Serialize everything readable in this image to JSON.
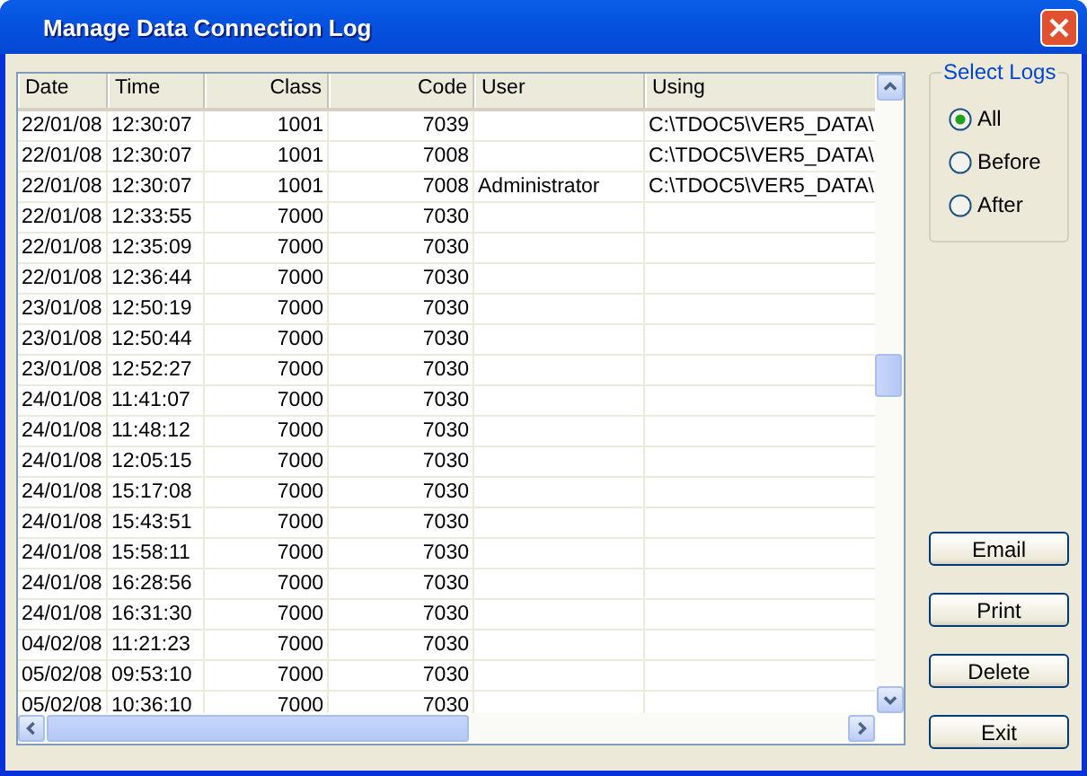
{
  "window": {
    "title": "Manage Data Connection Log"
  },
  "table": {
    "columns": [
      "Date",
      "Time",
      "Class",
      "Code",
      "User",
      "Using"
    ],
    "rows": [
      [
        "22/01/08",
        "12:30:07",
        "1001",
        "7039",
        "",
        "C:\\TDOC5\\VER5_DATA\\"
      ],
      [
        "22/01/08",
        "12:30:07",
        "1001",
        "7008",
        "",
        "C:\\TDOC5\\VER5_DATA\\"
      ],
      [
        "22/01/08",
        "12:30:07",
        "1001",
        "7008",
        "Administrator",
        "C:\\TDOC5\\VER5_DATA\\"
      ],
      [
        "22/01/08",
        "12:33:55",
        "7000",
        "7030",
        "",
        ""
      ],
      [
        "22/01/08",
        "12:35:09",
        "7000",
        "7030",
        "",
        ""
      ],
      [
        "22/01/08",
        "12:36:44",
        "7000",
        "7030",
        "",
        ""
      ],
      [
        "23/01/08",
        "12:50:19",
        "7000",
        "7030",
        "",
        ""
      ],
      [
        "23/01/08",
        "12:50:44",
        "7000",
        "7030",
        "",
        ""
      ],
      [
        "23/01/08",
        "12:52:27",
        "7000",
        "7030",
        "",
        ""
      ],
      [
        "24/01/08",
        "11:41:07",
        "7000",
        "7030",
        "",
        ""
      ],
      [
        "24/01/08",
        "11:48:12",
        "7000",
        "7030",
        "",
        ""
      ],
      [
        "24/01/08",
        "12:05:15",
        "7000",
        "7030",
        "",
        ""
      ],
      [
        "24/01/08",
        "15:17:08",
        "7000",
        "7030",
        "",
        ""
      ],
      [
        "24/01/08",
        "15:43:51",
        "7000",
        "7030",
        "",
        ""
      ],
      [
        "24/01/08",
        "15:58:11",
        "7000",
        "7030",
        "",
        ""
      ],
      [
        "24/01/08",
        "16:28:56",
        "7000",
        "7030",
        "",
        ""
      ],
      [
        "24/01/08",
        "16:31:30",
        "7000",
        "7030",
        "",
        ""
      ],
      [
        "04/02/08",
        "11:21:23",
        "7000",
        "7030",
        "",
        ""
      ],
      [
        "05/02/08",
        "09:53:10",
        "7000",
        "7030",
        "",
        ""
      ],
      [
        "05/02/08",
        "10:36:10",
        "7000",
        "7030",
        "",
        ""
      ]
    ]
  },
  "select_logs": {
    "title": "Select Logs",
    "options": [
      {
        "label": "All",
        "selected": true
      },
      {
        "label": "Before",
        "selected": false
      },
      {
        "label": "After",
        "selected": false
      }
    ]
  },
  "buttons": [
    "Email",
    "Print",
    "Delete",
    "Exit"
  ]
}
